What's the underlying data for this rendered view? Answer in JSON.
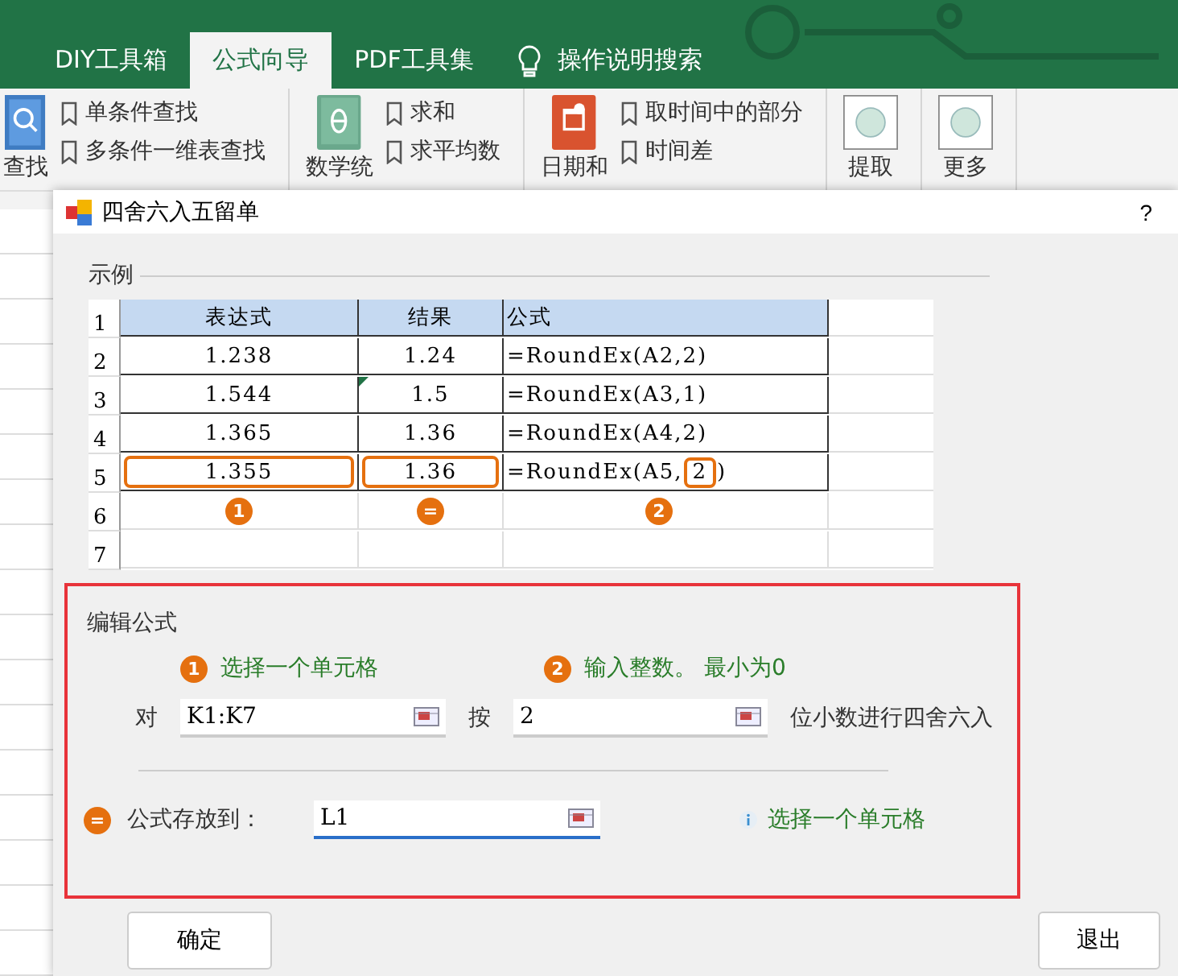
{
  "ribbon_tabs": [
    {
      "label": "DIY工具箱",
      "selected": false
    },
    {
      "label": "公式向导",
      "selected": true
    },
    {
      "label": "PDF工具集",
      "selected": false
    }
  ],
  "tell_me": "操作说明搜索",
  "ribbon_groups": [
    {
      "kind": "search",
      "label": "查找",
      "items": [
        "单条件查找",
        "多条件一维表查找"
      ]
    },
    {
      "kind": "math",
      "label": "数学统",
      "items": [
        "求和",
        "求平均数"
      ]
    },
    {
      "kind": "date",
      "label": "日期和",
      "items": [
        "取时间中的部分",
        "时间差"
      ]
    },
    {
      "kind": "plain",
      "label": "提取"
    },
    {
      "kind": "plain",
      "label": "更多"
    }
  ],
  "dialog": {
    "title": "四舍六入五留单",
    "help": "?",
    "example": {
      "title": "示例",
      "rows": [
        {
          "number": "1",
          "header": true,
          "cells": [
            {
              "text": "表达式"
            },
            {
              "text": "结果"
            },
            {
              "text": "公式"
            }
          ]
        },
        {
          "number": "2",
          "header": false,
          "cells": [
            {
              "text": "1.238"
            },
            {
              "text": "1.24"
            },
            {
              "text": "=RoundEx(A2,2)"
            }
          ]
        },
        {
          "number": "3",
          "header": false,
          "cells": [
            {
              "text": "1.544"
            },
            {
              "text": "1.5",
              "flagged": true
            },
            {
              "text": "=RoundEx(A3,1)"
            }
          ]
        },
        {
          "number": "4",
          "header": false,
          "cells": [
            {
              "text": "1.365"
            },
            {
              "text": "1.36"
            },
            {
              "text": "=RoundEx(A4,2)"
            }
          ]
        },
        {
          "number": "5",
          "header": false,
          "cells": [
            {
              "text": "1.355",
              "highlighted": true
            },
            {
              "text": "1.36",
              "highlighted": true
            },
            {
              "text": "=RoundEx(A5,",
              "boxed": "2",
              "after": ")"
            }
          ]
        },
        {
          "number": "6",
          "header": false,
          "cells": [
            {
              "marker": "1"
            },
            {
              "marker": "="
            },
            {
              "marker": "2"
            }
          ]
        },
        {
          "number": "7",
          "header": false,
          "cells": [
            {},
            {},
            {}
          ]
        }
      ]
    },
    "edit": {
      "title": "编辑公式",
      "step1": {
        "badge": "1",
        "hint": "选择一个单元格"
      },
      "step2": {
        "badge": "2",
        "hint": "输入整数。 最小为0"
      },
      "source_label": "对",
      "source_value": "K1:K7",
      "by_label": "按",
      "digits_value": "2",
      "suffix": "位小数进行四舍六入",
      "step3": {
        "badge": "=",
        "label": "公式存放到：",
        "value": "L1",
        "info": "选择一个单元格"
      }
    },
    "buttons": [
      "确定",
      "退出"
    ]
  }
}
